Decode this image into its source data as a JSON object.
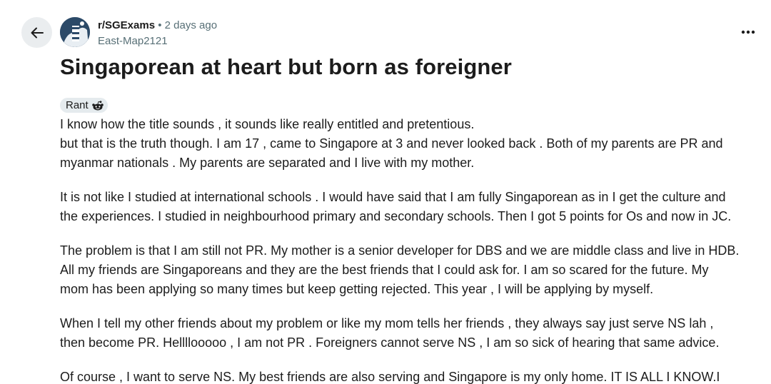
{
  "header": {
    "subreddit": "r/SGExams",
    "separator": "•",
    "time_ago": "2 days ago",
    "author": "East-Map2121"
  },
  "post": {
    "title": "Singaporean at heart but born as foreigner",
    "flair": "Rant",
    "paragraphs": [
      {
        "lines": [
          "I know how the title sounds , it sounds like really entitled and pretentious.",
          "but that is the truth though. I am 17 , came to Singapore at 3 and never looked back . Both of my parents are PR and",
          "myanmar nationals . My parents are separated and I live with my mother."
        ]
      },
      {
        "lines": [
          "It is not like I studied at international schools . I would have said that I am fully Singaporean as in I get the culture and",
          "the experiences. I studied in neighbourhood primary and secondary schools. Then I got 5 points for Os and now in JC."
        ]
      },
      {
        "lines": [
          "The problem is that I am still not PR. My mother is a senior developer for DBS and we are middle class and live in HDB.",
          "All my friends are Singaporeans and they are the best friends that I could ask for. I am so scared for the future. My",
          "mom has been applying so many times but keep getting rejected. This year , I will be applying by myself."
        ]
      },
      {
        "lines": [
          "When I tell my other friends about my problem or like my mom tells her friends , they always say just serve NS lah ,",
          "then become PR. Hellllooooo , I am not PR . Foreigners cannot serve NS , I am so sick of hearing that same advice."
        ]
      },
      {
        "lines": [
          "Of course , I want to serve NS. My best friends are also serving and Singapore is my only home. IT IS ALL I KNOW.I"
        ]
      }
    ]
  },
  "icons": {
    "back": "arrow-left-icon",
    "avatar": "subreddit-avatar-icon",
    "more": "more-options-icon",
    "flair_emoji": "reddit-snoo-icon"
  },
  "colors": {
    "text": "#1c1c1c",
    "meta": "#576f76",
    "back_bg": "#eaedef",
    "flair_bg": "#e5ebee"
  }
}
